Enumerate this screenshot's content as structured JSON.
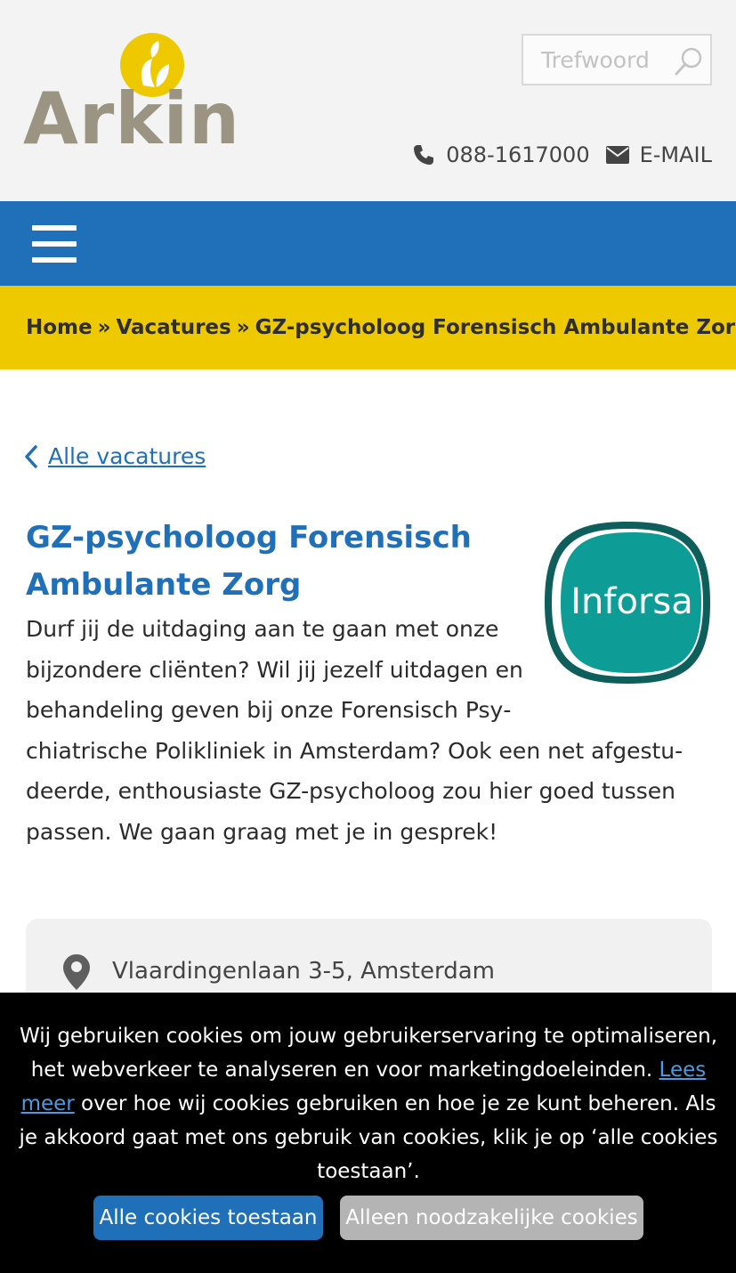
{
  "header": {
    "logo_text": "Arkin",
    "search_placeholder": "Trefwoord",
    "phone": "088-1617000",
    "email_label": "E-MAIL"
  },
  "breadcrumb": {
    "items": [
      "Home",
      "Vacatures",
      "GZ-psycholoog Forensisch Ambulante Zorg"
    ],
    "separator": "»"
  },
  "back_link": "Alle vacatures",
  "vacancy": {
    "title": "GZ-psycholoog Forensisch Am­bulante Zorg",
    "partner_logo_text": "Inforsa",
    "description": "Durf jij de uitdaging aan te gaan met onze bijzondere cliënten? Wil jij jezelf uitdagen en behandeling geven bij onze Forensisch Psy­chiatrische Polikliniek in Amsterdam? Ook een net afgestu­deerde, enthousiaste GZ-psycholoog zou hier goed tussen passen. We gaan graag met je in gesprek!",
    "location": "Vlaardingenlaan 3-5, Amsterdam"
  },
  "cookie_banner": {
    "text_before": "Wij gebruiken cookies om jouw gebruikerservaring te optimaliseren, het webverkeer te analyseren en voor marketingdoeleinden. ",
    "link": "Lees meer",
    "text_after": " over hoe wij cookies gebruiken en hoe je ze kunt beheren. Als je ak­koord gaat met ons gebruik van cookies, klik je op ‘alle cookies toestaan’.",
    "accept_all": "Alle cookies toestaan",
    "necessary_only": "Alleen noodzakelijke cookies"
  },
  "colors": {
    "brand_blue": "#1f70b8",
    "brand_yellow": "#eec900",
    "logo_grey": "#9b9482",
    "inforsa_teal": "#0e9c96"
  }
}
